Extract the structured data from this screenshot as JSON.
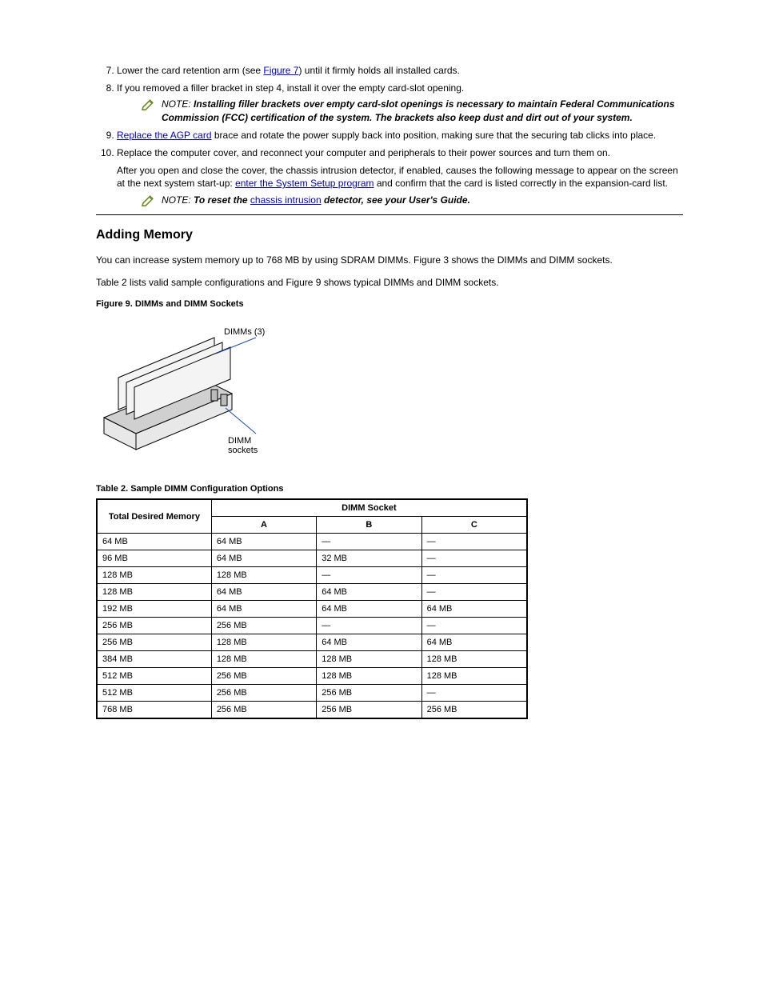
{
  "steps": [
    {
      "n": 7,
      "pre": "Lower the card retention arm (see ",
      "link": "Figure 7",
      "post": ") until it firmly holds all installed cards."
    },
    {
      "n": 8,
      "pre": "If you removed a filler bracket in step 4, install it over the empty card-",
      "link": null,
      "post": "slot opening."
    }
  ],
  "note1": {
    "label": "NOTE:",
    "body": " Installing filler brackets over empty card-slot openings is necessary to maintain Federal Communications Commission (FCC) certification of the system. The brackets also keep dust and dirt out of your system."
  },
  "steps2": [
    {
      "n": 9,
      "preLink": "Replace the AGP card",
      "mid": " brace and rotate the power supply back into position, making sure that the securing tab clicks into place."
    },
    {
      "n": 10,
      "pre": "Replace the computer cover, and reconnect your computer and peripherals to their power sources and turn them on."
    }
  ],
  "after10": {
    "pre": "After you open and close the cover, the chassis intrusion detector, if enabled, causes the following message to appear on the screen at the next system start-up: ",
    "link": "enter the System Setup program",
    "post": " and confirm that the card is listed correctly in the expansion-card list."
  },
  "note2": {
    "label": "NOTE:",
    "body": " To reset the ",
    "link": "chassis intrusion",
    "post": " detector, see your User's Guide."
  },
  "section": {
    "title": "Adding Memory",
    "p1": "You can increase system memory up to 768 MB by using SDRAM DIMMs. Figure 3 shows the DIMMs and DIMM sockets.",
    "p2": "Table 2 lists valid sample configurations and Figure 9 shows typical DIMMs and DIMM sockets.",
    "fig9": "Figure 9. DIMMs and DIMM Sockets",
    "tab2": "Table 2. Sample DIMM Configuration Options"
  },
  "table": {
    "headerTotal": "Total Desired Memory",
    "headerGroup": "DIMM Socket",
    "subA": "A",
    "subB": "B",
    "subC": "C",
    "rows": [
      {
        "total": "64 MB",
        "a": "64 MB",
        "b": "—",
        "c": "—"
      },
      {
        "total": "96 MB",
        "a": "64 MB",
        "b": "32 MB",
        "c": "—"
      },
      {
        "total": "128 MB",
        "a": "128 MB",
        "b": "—",
        "c": "—"
      },
      {
        "total": "128 MB",
        "a": "64 MB",
        "b": "64 MB",
        "c": "—"
      },
      {
        "total": "192 MB",
        "a": "64 MB",
        "b": "64 MB",
        "c": "64 MB"
      },
      {
        "total": "256 MB",
        "a": "256 MB",
        "b": "—",
        "c": "—"
      },
      {
        "total": "256 MB",
        "a": "128 MB",
        "b": "64 MB",
        "c": "64 MB"
      },
      {
        "total": "384 MB",
        "a": "128 MB",
        "b": "128 MB",
        "c": "128 MB"
      },
      {
        "total": "512 MB",
        "a": "256 MB",
        "b": "128 MB",
        "c": "128 MB"
      },
      {
        "total": "512 MB",
        "a": "256 MB",
        "b": "256 MB",
        "c": "—"
      },
      {
        "total": "768 MB",
        "a": "256 MB",
        "b": "256 MB",
        "c": "256 MB"
      }
    ]
  }
}
